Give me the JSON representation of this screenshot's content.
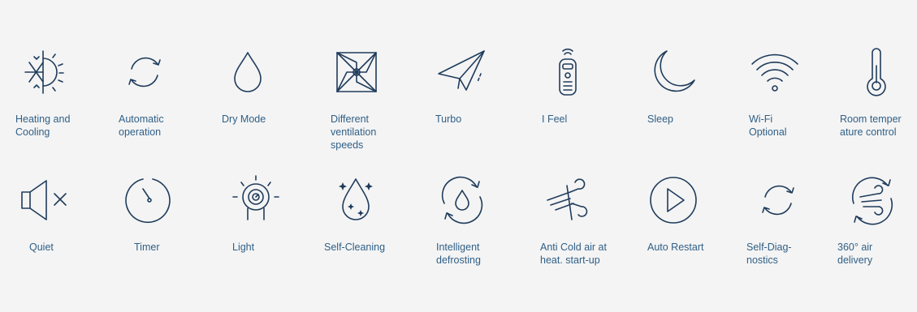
{
  "colors": {
    "background": "#f4f4f4",
    "icon_stroke": "#1f3c5c",
    "label_text": "#2f5f86"
  },
  "row1": [
    {
      "icon": "snowflake-sun-icon",
      "label": "Heating and\nCooling"
    },
    {
      "icon": "refresh-cycle-icon",
      "label": "Automatic\noperation"
    },
    {
      "icon": "water-drop-icon",
      "label": "Dry Mode"
    },
    {
      "icon": "pinwheel-icon",
      "label": "Different\nventilation\nspeeds"
    },
    {
      "icon": "paper-plane-icon",
      "label": "Turbo"
    },
    {
      "icon": "remote-control-icon",
      "label": "I Feel"
    },
    {
      "icon": "crescent-moon-icon",
      "label": "Sleep"
    },
    {
      "icon": "wifi-icon",
      "label": "Wi-Fi\nOptional"
    },
    {
      "icon": "thermometer-icon",
      "label": "Room temper\nature control"
    }
  ],
  "row2": [
    {
      "icon": "speaker-mute-icon",
      "label": "Quiet"
    },
    {
      "icon": "timer-icon",
      "label": "Timer"
    },
    {
      "icon": "light-icon",
      "label": "Light"
    },
    {
      "icon": "sparkle-drop-icon",
      "label": "Self-Cleaning"
    },
    {
      "icon": "defrost-cycle-icon",
      "label": "Intelligent\ndefrosting"
    },
    {
      "icon": "wind-gust-icon",
      "label": "Anti Cold air at\nheat. start-up"
    },
    {
      "icon": "play-circle-icon",
      "label": "Auto Restart"
    },
    {
      "icon": "diagnostics-cycle-icon",
      "label": "Self-Diag-\nnostics"
    },
    {
      "icon": "air-360-icon",
      "label": "360° air\ndelivery"
    }
  ]
}
